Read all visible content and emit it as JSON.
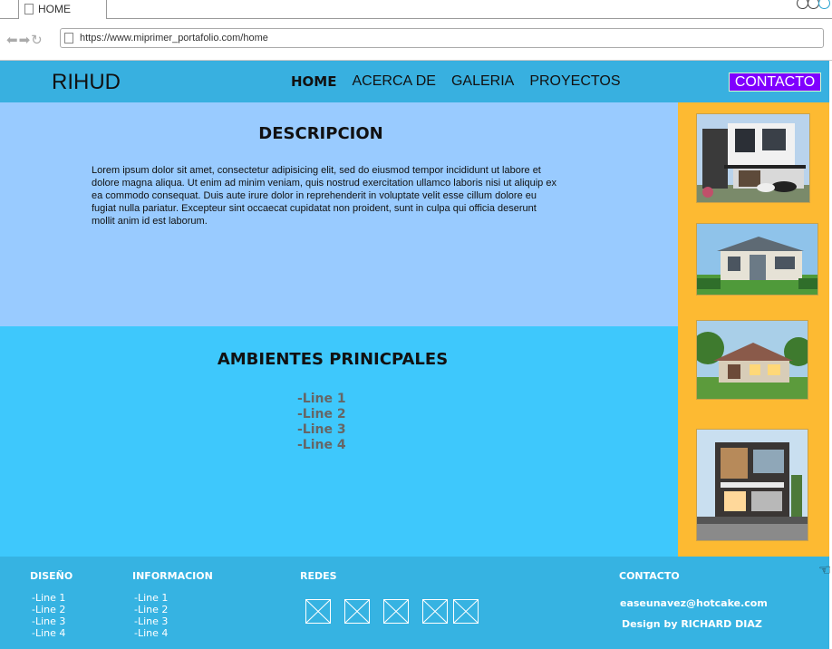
{
  "browser": {
    "tab_title": "HOME",
    "url": "https://www.miprimer_portafolio.com/home",
    "nav_glyphs": "⬅➡↻"
  },
  "header": {
    "logo": "RIHUD",
    "nav": [
      "HOME",
      "ACERCA DE",
      "GALERIA",
      "PROYECTOS"
    ],
    "contact_label": "CONTACTO",
    "accent": "#7f00ff",
    "bar_color": "#38b0e0"
  },
  "description": {
    "title": "DESCRIPCION",
    "text": "Lorem ipsum dolor sit amet, consectetur adipisicing elit, sed do eiusmod tempor incididunt ut labore et dolore magna aliqua. Ut enim ad minim veniam, quis nostrud exercitation ullamco laboris nisi ut aliquip ex ea commodo consequat. Duis aute irure dolor in reprehenderit in voluptate velit esse cillum dolore eu fugiat nulla pariatur. Excepteur sint occaecat cupidatat non proident, sunt in culpa qui officia deserunt mollit anim id est laborum."
  },
  "ambientes": {
    "title": "AMBIENTES PRINICPALES",
    "lines": [
      "-Line 1",
      "-Line 2",
      "-Line 3",
      "-Line 4"
    ]
  },
  "footer": {
    "diseno": {
      "title": "DISEÑO",
      "items": [
        "-Line 1",
        "-Line 2",
        "-Line 3",
        "-Line 4"
      ]
    },
    "informacion": {
      "title": "INFORMACION",
      "items": [
        "-Line 1",
        "-Line 2",
        "-Line 3",
        "-Line 4"
      ]
    },
    "redes": {
      "title": "REDES"
    },
    "contacto": {
      "title": "CONTACTO",
      "email": "easeunavez@hotcake.com",
      "credit": "Design by RICHARD DIAZ"
    }
  }
}
